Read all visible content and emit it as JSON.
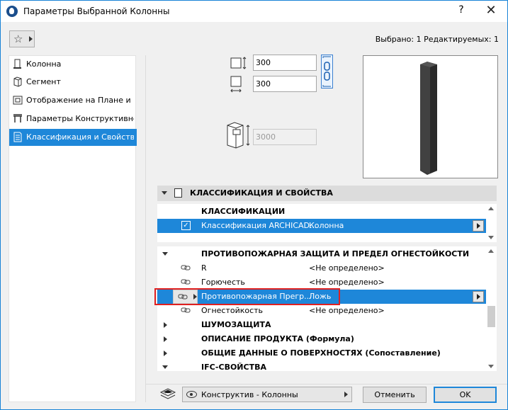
{
  "window": {
    "title": "Параметры Выбранной Колонны",
    "help_label": "?",
    "close_label": "✕"
  },
  "toolbar": {
    "selected_info": "Выбрано: 1 Редактируемых: 1"
  },
  "sidebar": {
    "items": [
      {
        "label": "Колонна",
        "icon": "column-icon",
        "active": false
      },
      {
        "label": "Сегмент",
        "icon": "segment-icon",
        "active": false
      },
      {
        "label": "Отображение на Плане и ...",
        "icon": "floor-plan-icon",
        "active": false
      },
      {
        "label": "Параметры Конструктивно...",
        "icon": "structural-icon",
        "active": false
      },
      {
        "label": "Классификация и Свойства",
        "icon": "classification-icon",
        "active": true
      }
    ]
  },
  "dimensions": {
    "width": "300",
    "depth": "300",
    "height": "3000"
  },
  "section": {
    "title": "КЛАССИФИКАЦИЯ И СВОЙСТВА"
  },
  "classification": {
    "group": "КЛАССИФИКАЦИИ",
    "row_name": "Классификация ARCHICAD...",
    "row_value": "Колонна"
  },
  "properties": {
    "fire_group": "ПРОТИВОПОЖАРНАЯ ЗАЩИТА И ПРЕДЕЛ ОГНЕСТОЙКОСТИ",
    "rows": [
      {
        "name": "R",
        "value": "<Не определено>"
      },
      {
        "name": "Горючесть",
        "value": "<Не определено>"
      },
      {
        "name": "Противопожарная Прегр...",
        "value": "Ложь"
      },
      {
        "name": "Огнестойкость",
        "value": "<Не определено>"
      }
    ],
    "collapsed_groups": [
      "ШУМОЗАЩИТА",
      "ОПИСАНИЕ ПРОДУКТА (Формула)",
      "ОБЩИЕ ДАННЫЕ О ПОВЕРХНОСТЯХ (Сопоставление)",
      "IFC-СВОЙСТВА"
    ]
  },
  "footer": {
    "layer_dropdown": "Конструктив - Колонны",
    "cancel_label": "Отменить",
    "ok_label": "OK"
  },
  "colors": {
    "accent": "#1e87d9",
    "highlight": "#e02020"
  }
}
